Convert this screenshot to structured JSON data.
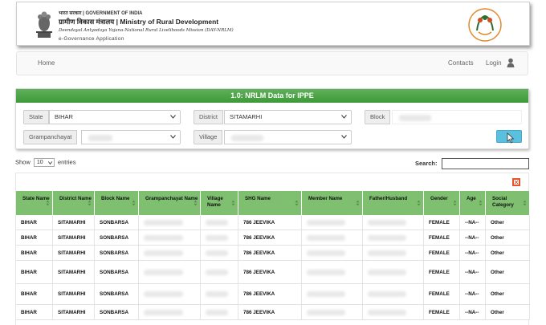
{
  "banner": {
    "gov_of_india": "भारत सरकार | GOVERNMENT OF INDIA",
    "ministry": "ग्रामीण विकास मंत्रालय | Ministry of Rural Development",
    "mission": "Deendayal Antyodaya Yojana-National Rural Livelihoods Mission (DAY-NRLM)",
    "app_name": "e-Governance Application",
    "logo_text": "आजीविका AAJEEVIKA"
  },
  "nav": {
    "home": "Home",
    "contacts": "Contacts",
    "login": "Login"
  },
  "panel": {
    "title": "1.0: NRLM Data for IPPE",
    "state_label": "State",
    "state_value": "BIHAR",
    "district_label": "District",
    "district_value": "SITAMARHI",
    "block_label": "Block",
    "gp_label": "Grampanchayat",
    "village_label": "Village"
  },
  "table_controls": {
    "show": "Show",
    "page_length": "10",
    "entries": "entries",
    "search_label": "Search:"
  },
  "table": {
    "columns": [
      "State Name",
      "District Name",
      "Block Name",
      "Grampanchayat Name",
      "Village Name",
      "SHG Name",
      "Member Name",
      "Father/Husband",
      "Gender",
      "Age",
      "Social Category"
    ],
    "rows": [
      {
        "state": "BIHAR",
        "district": "SITAMARHI",
        "block": "SONBARSA",
        "shg": "786 JEEVIKA",
        "gender": "FEMALE",
        "age": "--NA--",
        "category": "Other"
      },
      {
        "state": "BIHAR",
        "district": "SITAMARHI",
        "block": "SONBARSA",
        "shg": "786 JEEVIKA",
        "gender": "FEMALE",
        "age": "--NA--",
        "category": "Other"
      },
      {
        "state": "BIHAR",
        "district": "SITAMARHI",
        "block": "SONBARSA",
        "shg": "786 JEEVIKA",
        "gender": "FEMALE",
        "age": "--NA--",
        "category": "Other"
      },
      {
        "state": "BIHAR",
        "district": "SITAMARHI",
        "block": "SONBARSA",
        "shg": "786 JEEVIKA",
        "gender": "FEMALE",
        "age": "--NA--",
        "category": "Other"
      },
      {
        "state": "BIHAR",
        "district": "SITAMARHI",
        "block": "SONBARSA",
        "shg": "786 JEEVIKA",
        "gender": "FEMALE",
        "age": "--NA--",
        "category": "Other"
      },
      {
        "state": "BIHAR",
        "district": "SITAMARHI",
        "block": "SONBARSA",
        "shg": "786 JEEVIKA",
        "gender": "FEMALE",
        "age": "--NA--",
        "category": "Other"
      }
    ]
  },
  "colors": {
    "header_green": "#3d9a38",
    "table_head_green": "#7fbf70",
    "go_button": "#5bc0de"
  }
}
